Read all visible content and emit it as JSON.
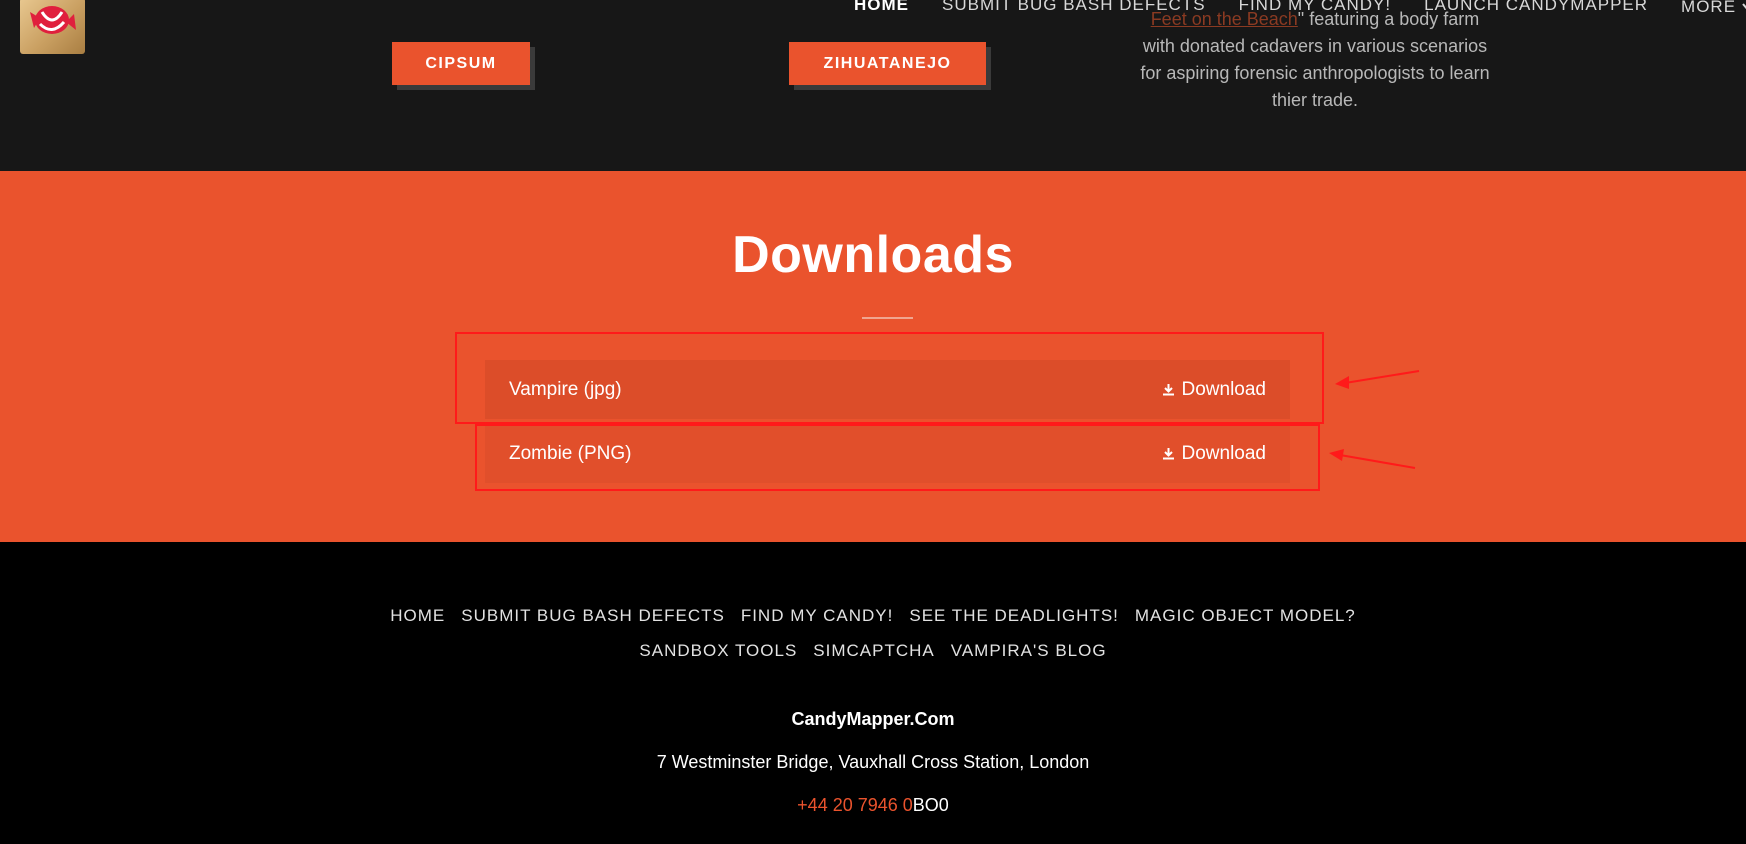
{
  "header": {
    "nav": [
      {
        "label": "HOME",
        "active": true
      },
      {
        "label": "SUBMIT BUG BASH DEFECTS",
        "active": false
      },
      {
        "label": "FIND MY CANDY!",
        "active": false
      },
      {
        "label": "LAUNCH CANDYMAPPER",
        "active": false
      }
    ],
    "more_label": "MORE"
  },
  "top_section": {
    "buttons": [
      "CIPSUM",
      "ZIHUATANEJO"
    ],
    "blurb": {
      "link_text": "Feet on the Beach",
      "tail": "\" featuring a body farm with donated cadavers in various scenarios for aspiring forensic anthropologists to learn thier trade."
    }
  },
  "downloads": {
    "title": "Downloads",
    "items": [
      {
        "name": "Vampire (jpg)",
        "action": "Download"
      },
      {
        "name": "Zombie (PNG)",
        "action": "Download"
      }
    ]
  },
  "footer": {
    "nav_row1": [
      "HOME",
      "SUBMIT BUG BASH DEFECTS",
      "FIND MY CANDY!",
      "SEE THE DEADLIGHTS!",
      "MAGIC OBJECT MODEL?"
    ],
    "nav_row2": [
      "SANDBOX TOOLS",
      "SIMCAPTCHA",
      "VAMPIRA'S BLOG"
    ],
    "site_name": "CandyMapper.Com",
    "address": "7 Westminster Bridge, Vauxhall Cross Station, London",
    "phone_red": "+44 20 7946 0",
    "phone_white": "BO0"
  },
  "colors": {
    "accent": "#ea532d",
    "annotation": "#ff1a1a"
  }
}
